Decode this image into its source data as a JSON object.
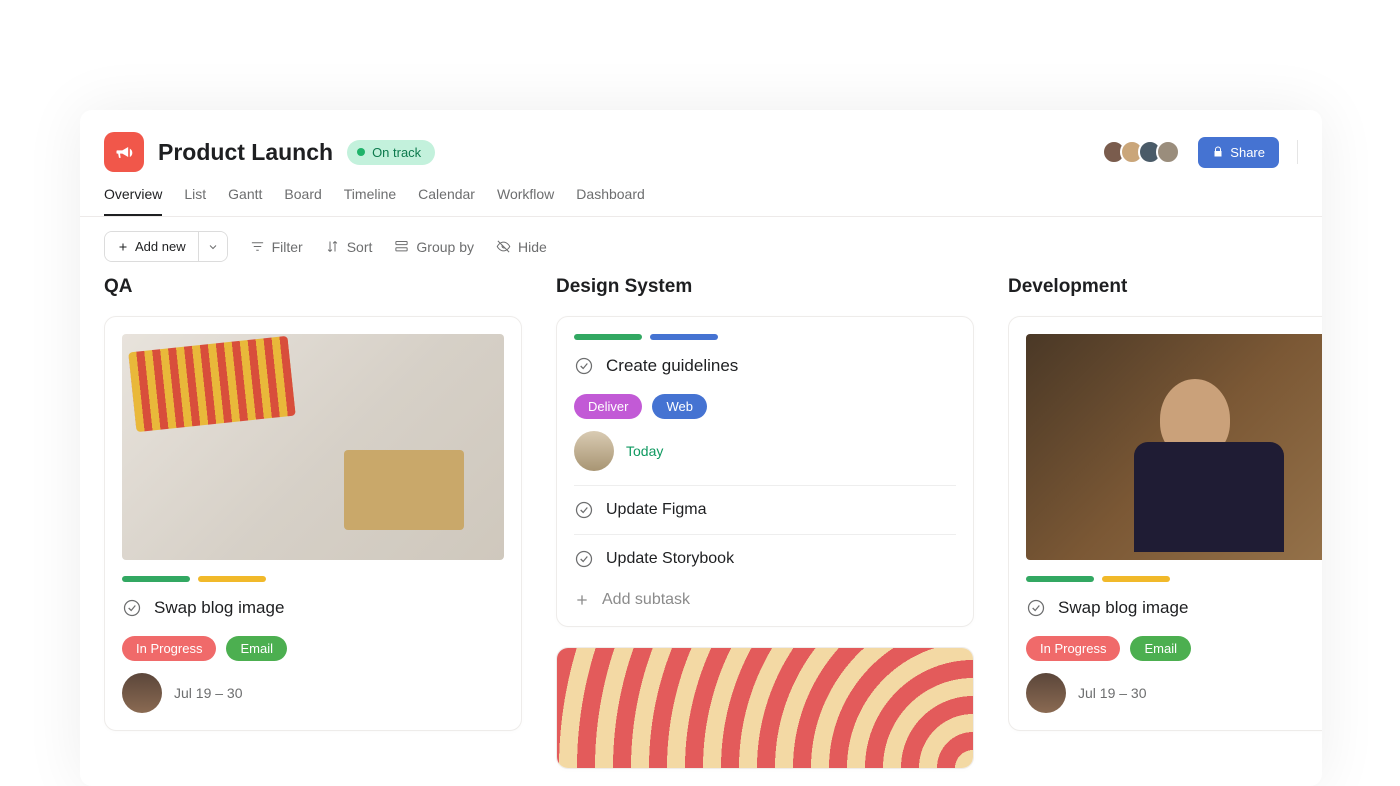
{
  "header": {
    "project_icon": "megaphone-icon",
    "title": "Product Launch",
    "status_label": "On track",
    "share_label": "Share",
    "members_count": 4
  },
  "tabs": [
    {
      "label": "Overview",
      "active": true
    },
    {
      "label": "List",
      "active": false
    },
    {
      "label": "Gantt",
      "active": false
    },
    {
      "label": "Board",
      "active": false
    },
    {
      "label": "Timeline",
      "active": false
    },
    {
      "label": "Calendar",
      "active": false
    },
    {
      "label": "Workflow",
      "active": false
    },
    {
      "label": "Dashboard",
      "active": false
    }
  ],
  "toolbar": {
    "add_new_label": "Add new",
    "items": [
      {
        "icon": "filter-icon",
        "label": "Filter"
      },
      {
        "icon": "sort-icon",
        "label": "Sort"
      },
      {
        "icon": "group-icon",
        "label": "Group by"
      },
      {
        "icon": "hide-icon",
        "label": "Hide"
      }
    ]
  },
  "columns": [
    {
      "title": "QA",
      "cards": [
        {
          "image": "desk",
          "chips": [
            "green",
            "yellow"
          ],
          "title": "Swap blog image",
          "tags": [
            {
              "label": "In Progress",
              "color": "red"
            },
            {
              "label": "Email",
              "color": "green2"
            }
          ],
          "date": "Jul 19 – 30",
          "date_class": ""
        }
      ]
    },
    {
      "title": "Design System",
      "cards": [
        {
          "chips": [
            "green",
            "blue"
          ],
          "title": "Create guidelines",
          "tags": [
            {
              "label": "Deliver",
              "color": "purple"
            },
            {
              "label": "Web",
              "color": "blue2"
            }
          ],
          "date": "Today",
          "date_class": "today",
          "subtasks": [
            {
              "label": "Update Figma"
            },
            {
              "label": "Update Storybook"
            }
          ],
          "add_subtask_label": "Add subtask"
        },
        {
          "image": "arcs"
        }
      ]
    },
    {
      "title": "Development",
      "cards": [
        {
          "image": "man",
          "chips": [
            "green",
            "yellow"
          ],
          "title": "Swap blog image",
          "tags": [
            {
              "label": "In Progress",
              "color": "red"
            },
            {
              "label": "Email",
              "color": "green2"
            }
          ],
          "date": "Jul 19 – 30",
          "date_class": ""
        }
      ]
    }
  ]
}
